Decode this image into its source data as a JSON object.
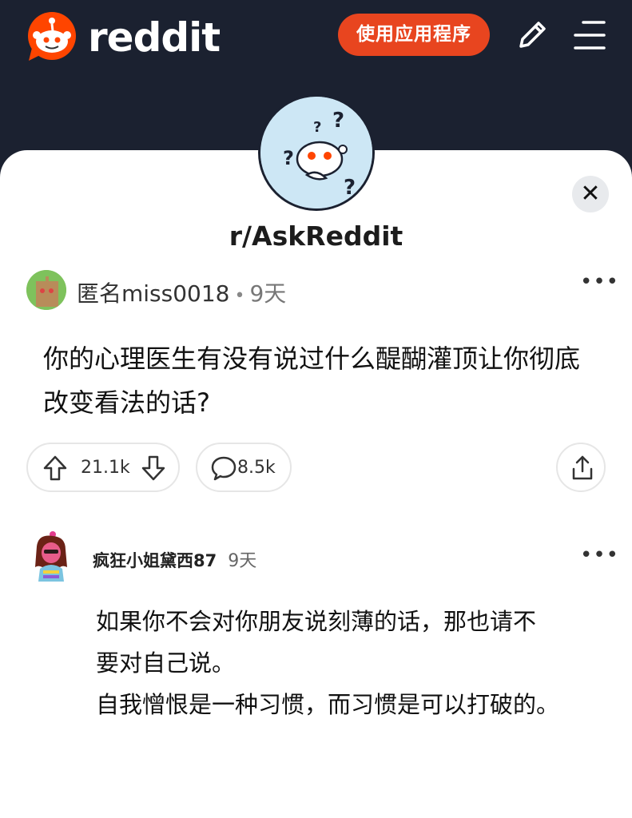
{
  "header": {
    "logo_text": "reddit",
    "app_button_label": "使用应用程序",
    "icons": [
      "reddit-logo-icon",
      "pencil-icon",
      "hamburger-menu-icon"
    ]
  },
  "community": {
    "name": "r/AskReddit",
    "avatar_icon": "askreddit-snoo-icon",
    "close_icon": "close-icon"
  },
  "post": {
    "author": "匿名miss0018",
    "separator": "•",
    "age": "9天",
    "title_line_1": "你的心理医生有没有说过什么醍醐灌顶让你彻底",
    "title_line_2": "改变看法的话?",
    "vote_count": "21.1k",
    "comment_count": "8.5k",
    "more_label": "•••"
  },
  "comment": {
    "author": "疯狂小姐黛西87",
    "age": "9天",
    "body_line_1": "如果你不会对你朋友说刻薄的话，那也请不",
    "body_line_2": "要对自己说。",
    "body_line_3": "自我憎恨是一种习惯，而习惯是可以打破的。",
    "more_label": "•••"
  },
  "colors": {
    "header_bg": "#1b2130",
    "brand_orange": "#e8451f",
    "sheet_bg": "#ffffff"
  }
}
